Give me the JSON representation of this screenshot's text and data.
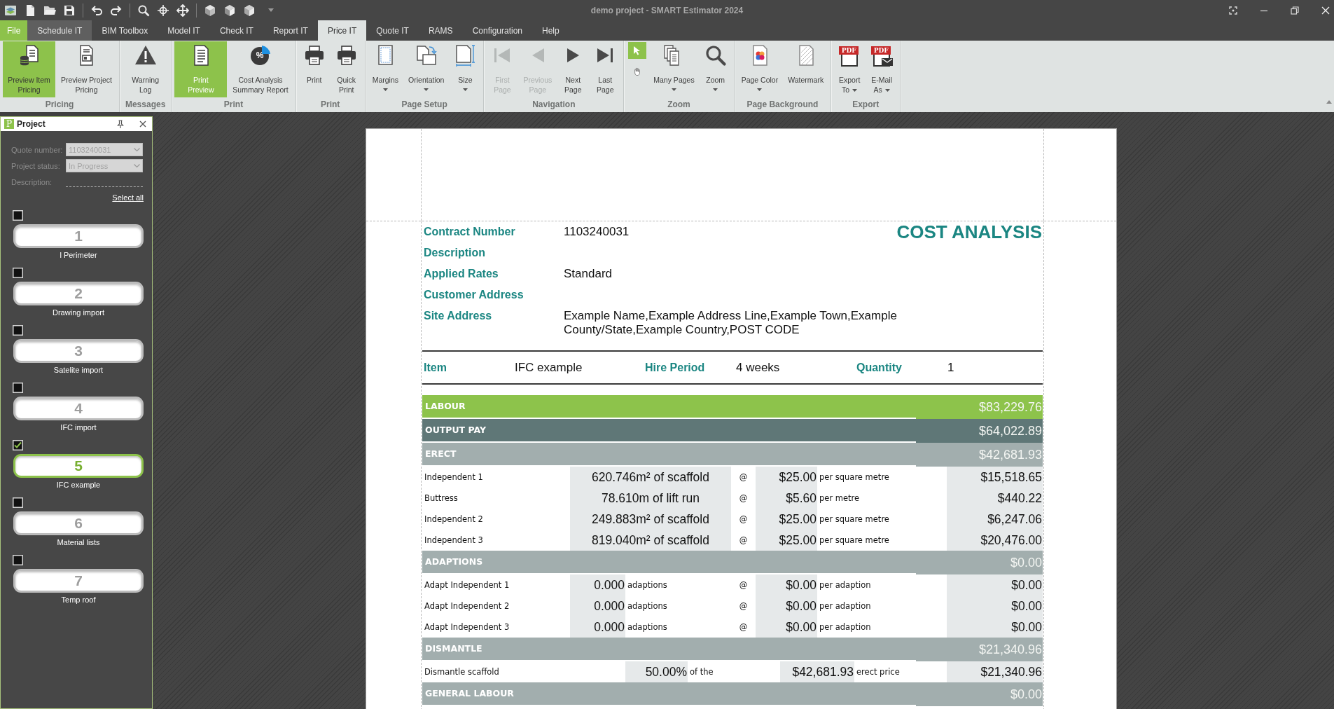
{
  "window": {
    "title": "demo project - SMART Estimator 2024"
  },
  "menu_tabs": [
    {
      "label": "File",
      "kind": "application",
      "selected": false,
      "hovered": false
    },
    {
      "label": "Schedule IT",
      "kind": "tab",
      "selected": false,
      "hovered": true
    },
    {
      "label": "BIM Toolbox",
      "kind": "tab",
      "selected": false,
      "hovered": false
    },
    {
      "label": "Model IT",
      "kind": "tab",
      "selected": false,
      "hovered": false
    },
    {
      "label": "Check IT",
      "kind": "tab",
      "selected": false,
      "hovered": false
    },
    {
      "label": "Report IT",
      "kind": "tab",
      "selected": false,
      "hovered": false
    },
    {
      "label": "Price IT",
      "kind": "tab",
      "selected": true,
      "hovered": false
    },
    {
      "label": "Quote IT",
      "kind": "tab",
      "selected": false,
      "hovered": false
    },
    {
      "label": "RAMS",
      "kind": "tab",
      "selected": false,
      "hovered": false
    },
    {
      "label": "Configuration",
      "kind": "tab",
      "selected": false,
      "hovered": false
    },
    {
      "label": "Help",
      "kind": "tab",
      "selected": false,
      "hovered": false
    }
  ],
  "ribbon": {
    "groups": [
      {
        "label": "Pricing",
        "buttons": [
          {
            "label": "Preview Item\nPricing",
            "selected": true,
            "hovered": true,
            "disabled": false,
            "dropdown": false
          },
          {
            "label": "Preview Project\nPricing",
            "selected": false,
            "hovered": false,
            "disabled": false,
            "dropdown": false
          }
        ]
      },
      {
        "label": "Messages",
        "buttons": [
          {
            "label": "Warning\nLog",
            "selected": false,
            "hovered": false,
            "disabled": false,
            "dropdown": false
          }
        ]
      },
      {
        "label": "Print",
        "buttons": [
          {
            "label": "Print\nPreview",
            "selected": true,
            "hovered": false,
            "disabled": false,
            "dropdown": false
          },
          {
            "label": "Cost Analysis\nSummary Report",
            "icon_text": "%",
            "selected": false,
            "hovered": false,
            "disabled": false,
            "dropdown": false
          }
        ]
      },
      {
        "label": "Print",
        "buttons": [
          {
            "label": "Print",
            "selected": false,
            "hovered": false,
            "disabled": false,
            "dropdown": false
          },
          {
            "label": "Quick\nPrint",
            "selected": false,
            "hovered": false,
            "disabled": false,
            "dropdown": false
          }
        ]
      },
      {
        "label": "Page Setup",
        "buttons": [
          {
            "label": "Margins",
            "selected": false,
            "hovered": false,
            "disabled": false,
            "dropdown": true
          },
          {
            "label": "Orientation",
            "selected": false,
            "hovered": false,
            "disabled": false,
            "dropdown": true
          },
          {
            "label": "Size",
            "selected": false,
            "hovered": false,
            "disabled": false,
            "dropdown": true
          }
        ]
      },
      {
        "label": "Navigation",
        "buttons": [
          {
            "label": "First\nPage",
            "selected": false,
            "hovered": false,
            "disabled": true,
            "dropdown": false
          },
          {
            "label": "Previous\nPage",
            "selected": false,
            "hovered": false,
            "disabled": true,
            "dropdown": false
          },
          {
            "label": "Next\nPage",
            "selected": false,
            "hovered": false,
            "disabled": false,
            "dropdown": false
          },
          {
            "label": "Last\nPage",
            "selected": false,
            "hovered": false,
            "disabled": false,
            "dropdown": false
          }
        ]
      },
      {
        "label": "Zoom",
        "tools": [
          {
            "selected": true
          },
          {
            "selected": false
          }
        ],
        "buttons": [
          {
            "label": "Many Pages",
            "selected": false,
            "hovered": false,
            "disabled": false,
            "dropdown": true
          },
          {
            "label": "Zoom",
            "selected": false,
            "hovered": false,
            "disabled": false,
            "dropdown": true
          }
        ]
      },
      {
        "label": "Page Background",
        "buttons": [
          {
            "label": "Page Color",
            "selected": false,
            "hovered": false,
            "disabled": false,
            "dropdown": true
          },
          {
            "label": "Watermark",
            "selected": false,
            "hovered": false,
            "disabled": false,
            "dropdown": false
          }
        ]
      },
      {
        "label": "Export",
        "buttons": [
          {
            "label": "Export\nTo",
            "icon_text": "PDF",
            "selected": false,
            "hovered": false,
            "disabled": false,
            "dropdown": true
          },
          {
            "label": "E-Mail\nAs",
            "icon_text": "PDF",
            "selected": false,
            "hovered": false,
            "disabled": false,
            "dropdown": true
          }
        ]
      }
    ]
  },
  "project_panel": {
    "icon_text": "P",
    "title": "Project",
    "fields": [
      {
        "label": "Quote number:",
        "kind": "dropdown",
        "value": "1103240031",
        "disabled": true
      },
      {
        "label": "Project status:",
        "kind": "dropdown",
        "value": "In Progress",
        "disabled": true
      },
      {
        "label": "Description:",
        "kind": "text",
        "disabled": true
      }
    ],
    "select_all": "Select all",
    "items": [
      {
        "number": "1",
        "name": "l Perimeter",
        "checked": false,
        "selected": false
      },
      {
        "number": "2",
        "name": "Drawing import",
        "checked": false,
        "selected": false
      },
      {
        "number": "3",
        "name": "Satelite import",
        "checked": false,
        "selected": false
      },
      {
        "number": "4",
        "name": "IFC import",
        "checked": false,
        "selected": false
      },
      {
        "number": "5",
        "name": "IFC example",
        "checked": true,
        "selected": true
      },
      {
        "number": "6",
        "name": "Material lists",
        "checked": false,
        "selected": false
      },
      {
        "number": "7",
        "name": "Temp roof",
        "checked": false,
        "selected": false
      }
    ]
  },
  "report": {
    "title": "COST ANALYSIS",
    "details": [
      {
        "label": "Contract Number",
        "value": "1103240031"
      },
      {
        "label": "Description"
      },
      {
        "label": "Applied Rates",
        "value": "Standard"
      },
      {
        "label": "Customer Address"
      },
      {
        "label": "Site Address",
        "value": "Example Name,Example Address Line,Example Town,Example County/State,Example Country,POST CODE"
      }
    ],
    "item_line": [
      {
        "label": "Item",
        "value": "IFC example"
      },
      {
        "label": "Hire Period",
        "value": "4 weeks"
      },
      {
        "label": "Quantity",
        "value": "1"
      }
    ],
    "rows": [
      {
        "kind": "total",
        "label": "LABOUR",
        "amount": "$83,229.76"
      },
      {
        "kind": "group",
        "label": "OUTPUT PAY",
        "amount": "$64,022.89"
      },
      {
        "kind": "section",
        "label": "ERECT",
        "amount": "$42,681.93"
      },
      {
        "kind": "rate_line",
        "name": "Independent 1",
        "quantity": "620.746m² of scaffold",
        "at": "@",
        "rate": "$25.00",
        "unit": "per square metre",
        "amount": "$15,518.65"
      },
      {
        "kind": "rate_line",
        "name": "Buttress",
        "quantity": "78.610m of lift run",
        "at": "@",
        "rate": "$5.60",
        "unit": "per metre",
        "amount": "$440.22"
      },
      {
        "kind": "rate_line",
        "name": "Independent 2",
        "quantity": "249.883m² of scaffold",
        "at": "@",
        "rate": "$25.00",
        "unit": "per square metre",
        "amount": "$6,247.06"
      },
      {
        "kind": "rate_line",
        "name": "Independent 3",
        "quantity": "819.040m² of scaffold",
        "at": "@",
        "rate": "$25.00",
        "unit": "per square metre",
        "amount": "$20,476.00"
      },
      {
        "kind": "section",
        "label": "ADAPTIONS",
        "amount": "$0.00"
      },
      {
        "kind": "count_line",
        "name": "Adapt Independent 1",
        "quantity": "0.000",
        "quantity_unit": "adaptions",
        "at": "@",
        "rate": "$0.00",
        "unit": "per adaption",
        "amount": "$0.00"
      },
      {
        "kind": "count_line",
        "name": "Adapt Independent 2",
        "quantity": "0.000",
        "quantity_unit": "adaptions",
        "at": "@",
        "rate": "$0.00",
        "unit": "per adaption",
        "amount": "$0.00"
      },
      {
        "kind": "count_line",
        "name": "Adapt Independent 3",
        "quantity": "0.000",
        "quantity_unit": "adaptions",
        "at": "@",
        "rate": "$0.00",
        "unit": "per adaption",
        "amount": "$0.00"
      },
      {
        "kind": "section",
        "label": "DISMANTLE",
        "amount": "$21,340.96"
      },
      {
        "kind": "percent_line",
        "name": "Dismantle scaffold",
        "percent": "50.00%",
        "percent_of": "of the",
        "base": "$42,681.93",
        "base_note": "erect price",
        "amount": "$21,340.96"
      },
      {
        "kind": "section",
        "label": "GENERAL LABOUR",
        "amount": "$0.00"
      }
    ]
  }
}
